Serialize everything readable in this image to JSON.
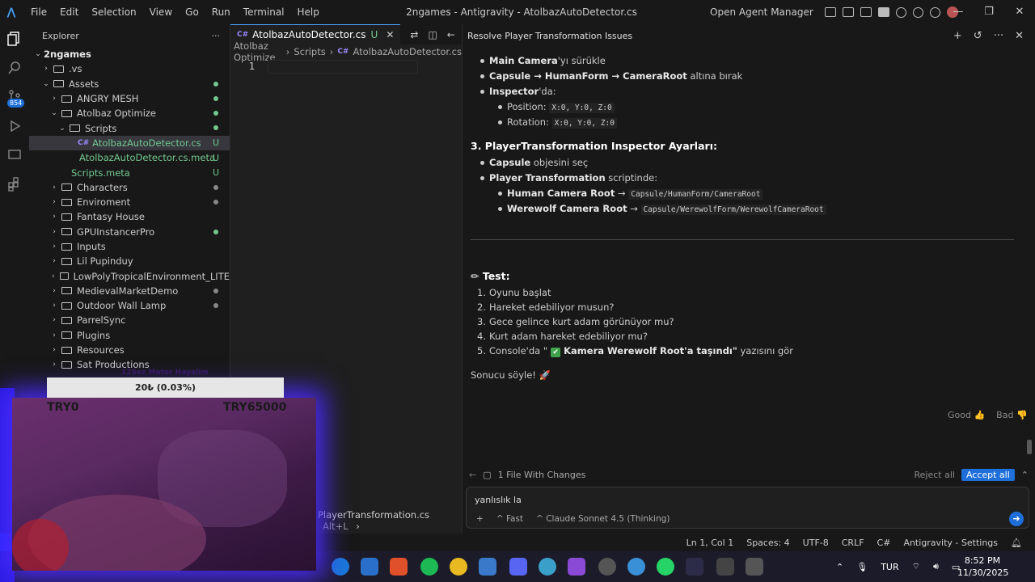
{
  "titlebar": {
    "menu": [
      "File",
      "Edit",
      "Selection",
      "View",
      "Go",
      "Run",
      "Terminal",
      "Help"
    ],
    "title": "2ngames - Antigravity - AtolbazAutoDetector.cs",
    "agent_manager": "Open Agent Manager",
    "window_controls": [
      "—",
      "❐",
      "✕"
    ]
  },
  "activity": {
    "badge": "854"
  },
  "explorer": {
    "header": "Explorer",
    "more": "···",
    "root": "2ngames",
    "items": [
      {
        "label": ".vs",
        "depth": 1,
        "type": "folder",
        "open": false,
        "status": ""
      },
      {
        "label": "Assets",
        "depth": 1,
        "type": "folder",
        "open": true,
        "status": "dot"
      },
      {
        "label": "ANGRY MESH",
        "depth": 2,
        "type": "folder",
        "open": false,
        "status": "dot"
      },
      {
        "label": "Atolbaz Optimize",
        "depth": 2,
        "type": "folder",
        "open": true,
        "status": "dot"
      },
      {
        "label": "Scripts",
        "depth": 3,
        "type": "folder",
        "open": true,
        "status": "dot"
      },
      {
        "label": "AtolbazAutoDetector.cs",
        "depth": 4,
        "type": "cs",
        "open": false,
        "status": "U",
        "selected": true
      },
      {
        "label": "AtolbazAutoDetector.cs.meta",
        "depth": 4,
        "type": "meta",
        "open": false,
        "status": "U"
      },
      {
        "label": "Scripts.meta",
        "depth": 3,
        "type": "meta",
        "open": false,
        "status": "U"
      },
      {
        "label": "Characters",
        "depth": 2,
        "type": "folder",
        "open": false,
        "status": "dotgray"
      },
      {
        "label": "Enviroment",
        "depth": 2,
        "type": "folder",
        "open": false,
        "status": "dotgray"
      },
      {
        "label": "Fantasy House",
        "depth": 2,
        "type": "folder",
        "open": false,
        "status": ""
      },
      {
        "label": "GPUInstancerPro",
        "depth": 2,
        "type": "folder",
        "open": false,
        "status": "dot"
      },
      {
        "label": "Inputs",
        "depth": 2,
        "type": "folder",
        "open": false,
        "status": ""
      },
      {
        "label": "Lil Pupinduy",
        "depth": 2,
        "type": "folder",
        "open": false,
        "status": ""
      },
      {
        "label": "LowPolyTropicalEnvironment_LITE",
        "depth": 2,
        "type": "folder",
        "open": false,
        "status": ""
      },
      {
        "label": "MedievalMarketDemo",
        "depth": 2,
        "type": "folder",
        "open": false,
        "status": "dotgray"
      },
      {
        "label": "Outdoor Wall Lamp",
        "depth": 2,
        "type": "folder",
        "open": false,
        "status": "dotgray"
      },
      {
        "label": "ParrelSync",
        "depth": 2,
        "type": "folder",
        "open": false,
        "status": ""
      },
      {
        "label": "Plugins",
        "depth": 2,
        "type": "folder",
        "open": false,
        "status": ""
      },
      {
        "label": "Resources",
        "depth": 2,
        "type": "folder",
        "open": false,
        "status": ""
      },
      {
        "label": "Sat Productions",
        "depth": 2,
        "type": "folder",
        "open": false,
        "status": ""
      }
    ]
  },
  "editor": {
    "tab_label": "AtolbazAutoDetector.cs",
    "tab_status": "U",
    "breadcrumb": [
      "Atolbaz Optimize",
      "Scripts",
      "AtolbazAutoDetector.cs"
    ],
    "line_number": "1",
    "bottom_file": "PlayerTransformation.cs",
    "bottom_shortcut": "Alt+L"
  },
  "chat": {
    "title": "Resolve Player Transformation Issues",
    "bullets_top": [
      {
        "bold": "Main Camera",
        "rest": "'yı sürükle"
      },
      {
        "bold": "Capsule → HumanForm → CameraRoot",
        "rest": " altına bırak"
      },
      {
        "bold": "Inspector",
        "rest": "'da:"
      }
    ],
    "position_label": "Position:",
    "position_code": "X:0, Y:0, Z:0",
    "rotation_label": "Rotation:",
    "rotation_code": "X:0, Y:0, Z:0",
    "section3": "3. PlayerTransformation Inspector Ayarları:",
    "capsule_bold": "Capsule",
    "capsule_rest": " objesini seç",
    "pt_bold": "Player Transformation",
    "pt_rest": " scriptinde:",
    "human_bold": "Human Camera Root",
    "human_arrow": " → ",
    "human_code": "Capsule/HumanForm/CameraRoot",
    "wolf_bold": "Werewolf Camera Root",
    "wolf_arrow": " → ",
    "wolf_code": "Capsule/WerewolfForm/WerewolfCameraRoot",
    "test_heading": "✏ Test:",
    "test_steps": [
      "Oyunu başlat",
      "Hareket edebiliyor musun?",
      "Gece gelince kurt adam görünüyor mu?",
      "Kurt adam hareket edebiliyor mu?"
    ],
    "step5_prefix": "Console'da \"",
    "step5_check": "✔",
    "step5_bold": "Kamera Werewolf Root'a taşındı\"",
    "step5_suffix": " yazısını gör",
    "closing": "Sonucu söyle! 🚀",
    "good": "Good 👍",
    "bad": "Bad 👎",
    "changes": "1 File With Changes",
    "reject_all": "Reject all",
    "accept_all": "Accept all",
    "input_text": "yanlıslık la",
    "mode": "Fast",
    "model": "Claude Sonnet 4.5 (Thinking)"
  },
  "status": {
    "position": "Ln 1, Col 1",
    "spaces": "Spaces: 4",
    "encoding": "UTF-8",
    "eol": "CRLF",
    "language": "C#",
    "settings": "Antigravity - Settings"
  },
  "taskbar": {
    "lang": "TUR",
    "time": "8:52 PM",
    "date": "11/30/2025"
  },
  "overlay": {
    "donation_title": "12Sez Motor Hayalim",
    "donation_progress": "20₺ (0.03%)",
    "progress_fraction": 0.0003,
    "min_label": "TRY0",
    "max_label": "TRY65000"
  }
}
